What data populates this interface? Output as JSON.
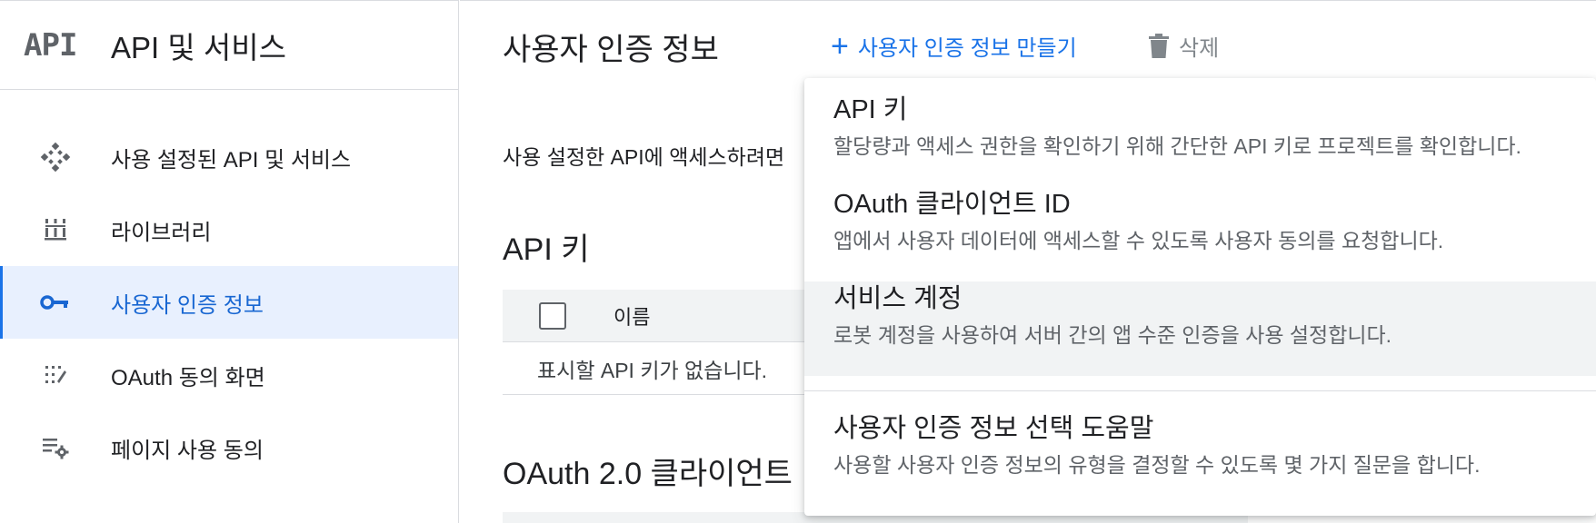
{
  "sidebar": {
    "logo": "API",
    "product_title": "API 및 서비스",
    "items": [
      {
        "label": "사용 설정된 API 및 서비스",
        "icon": "enabled-apis-icon",
        "active": false
      },
      {
        "label": "라이브러리",
        "icon": "library-icon",
        "active": false
      },
      {
        "label": "사용자 인증 정보",
        "icon": "key-icon",
        "active": true
      },
      {
        "label": "OAuth 동의 화면",
        "icon": "consent-screen-icon",
        "active": false
      },
      {
        "label": "페이지 사용 동의",
        "icon": "page-usage-settings-icon",
        "active": false
      }
    ]
  },
  "main": {
    "title": "사용자 인증 정보",
    "create_label": "사용자 인증 정보 만들기",
    "delete_label": "삭제",
    "intro_text": "사용 설정한 API에 액세스하려면",
    "api_keys": {
      "heading": "API 키",
      "column_name": "이름",
      "empty_text": "표시할 API 키가 없습니다."
    },
    "oauth_heading": "OAuth 2.0 클라이언트"
  },
  "menu": {
    "items": [
      {
        "title": "API 키",
        "desc": "할당량과 액세스 권한을 확인하기 위해 간단한 API 키로 프로젝트를 확인합니다."
      },
      {
        "title": "OAuth 클라이언트 ID",
        "desc": "앱에서 사용자 데이터에 액세스할 수 있도록 사용자 동의를 요청합니다."
      },
      {
        "title": "서비스 계정",
        "desc": "로봇 계정을 사용하여 서버 간의 앱 수준 인증을 사용 설정합니다."
      }
    ],
    "help": {
      "title": "사용자 인증 정보 선택 도움말",
      "desc": "사용할 사용자 인증 정보의 유형을 결정할 수 있도록 몇 가지 질문을 합니다."
    }
  },
  "colors": {
    "accent": "#1a73e8",
    "active_bg": "#e8f0fe",
    "icon_gray": "#5f6368"
  }
}
